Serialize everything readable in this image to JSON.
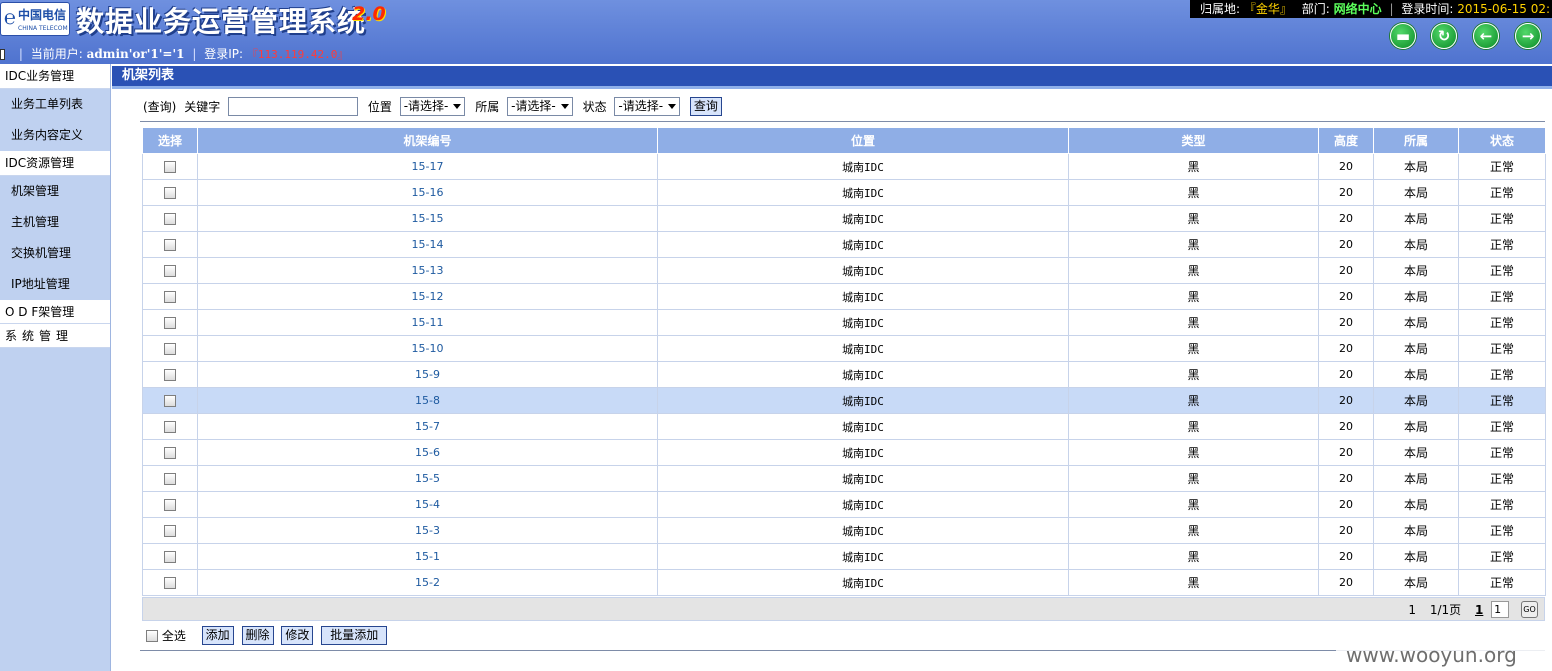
{
  "header": {
    "logo_cn": "中国电信",
    "logo_en": "CHINA TELECOM",
    "title": "数据业务运营管理系统",
    "version": "2.0"
  },
  "topinfo": {
    "owner_label": "归属地:",
    "owner_value": "『金华』",
    "dept_label": "部门:",
    "dept_value": "网络中心",
    "login_time_label": "登录时间:",
    "login_time_value": "2015-06-15 02:"
  },
  "userbar": {
    "current_user_label": "当前用户:",
    "current_user_value": "admin'or'1'='1",
    "login_ip_label": "登录IP:",
    "login_ip_value": "『113.119.42.0』"
  },
  "header_buttons": [
    {
      "name": "card-icon",
      "glyph": "▬"
    },
    {
      "name": "refresh-icon",
      "glyph": "↻"
    },
    {
      "name": "back-arrow-icon",
      "glyph": "←"
    },
    {
      "name": "forward-arrow-icon",
      "glyph": "→"
    }
  ],
  "sidebar": {
    "group_idc_business": "IDC业务管理",
    "item_work_orders": "业务工单列表",
    "item_content_def": "业务内容定义",
    "group_idc_resource": "IDC资源管理",
    "item_rack": "机架管理",
    "item_host": "主机管理",
    "item_switch": "交换机管理",
    "item_ip": "IP地址管理",
    "group_odf": "O D F架管理",
    "group_system": "系统管理"
  },
  "main": {
    "title": "机架列表"
  },
  "search": {
    "query_label": "(查询)",
    "keyword_label": "关键字",
    "keyword_value": "",
    "location_label": "位置",
    "location_select": "-请选择-",
    "owner_label": "所属",
    "owner_select": "-请选择-",
    "status_label": "状态",
    "status_select": "-请选择-",
    "search_button": "查询"
  },
  "table": {
    "headers": [
      "选择",
      "机架编号",
      "位置",
      "类型",
      "高度",
      "所属",
      "状态"
    ],
    "rows": [
      {
        "code": "15-17",
        "location": "城南IDC",
        "type": "黑",
        "height": "20",
        "owner": "本局",
        "status": "正常"
      },
      {
        "code": "15-16",
        "location": "城南IDC",
        "type": "黑",
        "height": "20",
        "owner": "本局",
        "status": "正常"
      },
      {
        "code": "15-15",
        "location": "城南IDC",
        "type": "黑",
        "height": "20",
        "owner": "本局",
        "status": "正常"
      },
      {
        "code": "15-14",
        "location": "城南IDC",
        "type": "黑",
        "height": "20",
        "owner": "本局",
        "status": "正常"
      },
      {
        "code": "15-13",
        "location": "城南IDC",
        "type": "黑",
        "height": "20",
        "owner": "本局",
        "status": "正常"
      },
      {
        "code": "15-12",
        "location": "城南IDC",
        "type": "黑",
        "height": "20",
        "owner": "本局",
        "status": "正常"
      },
      {
        "code": "15-11",
        "location": "城南IDC",
        "type": "黑",
        "height": "20",
        "owner": "本局",
        "status": "正常"
      },
      {
        "code": "15-10",
        "location": "城南IDC",
        "type": "黑",
        "height": "20",
        "owner": "本局",
        "status": "正常"
      },
      {
        "code": "15-9",
        "location": "城南IDC",
        "type": "黑",
        "height": "20",
        "owner": "本局",
        "status": "正常"
      },
      {
        "code": "15-8",
        "location": "城南IDC",
        "type": "黑",
        "height": "20",
        "owner": "本局",
        "status": "正常",
        "highlighted": true
      },
      {
        "code": "15-7",
        "location": "城南IDC",
        "type": "黑",
        "height": "20",
        "owner": "本局",
        "status": "正常"
      },
      {
        "code": "15-6",
        "location": "城南IDC",
        "type": "黑",
        "height": "20",
        "owner": "本局",
        "status": "正常"
      },
      {
        "code": "15-5",
        "location": "城南IDC",
        "type": "黑",
        "height": "20",
        "owner": "本局",
        "status": "正常"
      },
      {
        "code": "15-4",
        "location": "城南IDC",
        "type": "黑",
        "height": "20",
        "owner": "本局",
        "status": "正常"
      },
      {
        "code": "15-3",
        "location": "城南IDC",
        "type": "黑",
        "height": "20",
        "owner": "本局",
        "status": "正常"
      },
      {
        "code": "15-1",
        "location": "城南IDC",
        "type": "黑",
        "height": "20",
        "owner": "本局",
        "status": "正常"
      },
      {
        "code": "15-2",
        "location": "城南IDC",
        "type": "黑",
        "height": "20",
        "owner": "本局",
        "status": "正常"
      }
    ]
  },
  "pager": {
    "total": "1",
    "page_info": "1/1页",
    "current_page": "1",
    "page_input": "1",
    "go_label": "GO"
  },
  "actions": {
    "select_all": "全选",
    "add": "添加",
    "delete": "删除",
    "edit": "修改",
    "batch_add": "批量添加"
  },
  "watermark": "www.wooyun.org",
  "colors": {
    "header_blue": "#5b7fd6",
    "title_bar": "#2a51b5",
    "table_header": "#8faee6",
    "sidebar": "#bfd1f0",
    "link": "#1e5aa0",
    "highlight_row": "#c8daf7"
  }
}
